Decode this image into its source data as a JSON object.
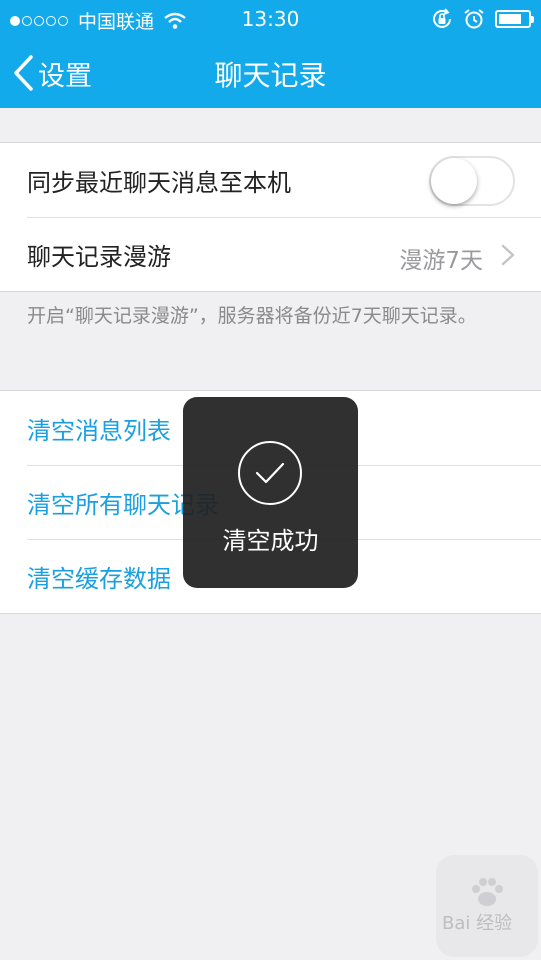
{
  "status_bar": {
    "carrier": "中国联通",
    "time": "13:30",
    "signal_dots_filled": 1,
    "signal_dots_total": 5,
    "battery_level_percent": 80
  },
  "nav": {
    "back_label": "设置",
    "title": "聊天记录"
  },
  "sync_section": {
    "sync_label": "同步最近聊天消息至本机",
    "sync_enabled": false,
    "roaming_label": "聊天记录漫游",
    "roaming_value": "漫游7天"
  },
  "note": "开启“聊天记录漫游”，服务器将备份近7天聊天记录。",
  "actions": {
    "clear_message_list": "清空消息列表",
    "clear_all_chats": "清空所有聊天记录",
    "clear_cache": "清空缓存数据"
  },
  "toast": {
    "text": "清空成功"
  },
  "watermark": {
    "text": "Bai 经验"
  },
  "colors": {
    "accent": "#12aaeb",
    "link": "#1aa0e0",
    "background": "#f0f0f3"
  }
}
